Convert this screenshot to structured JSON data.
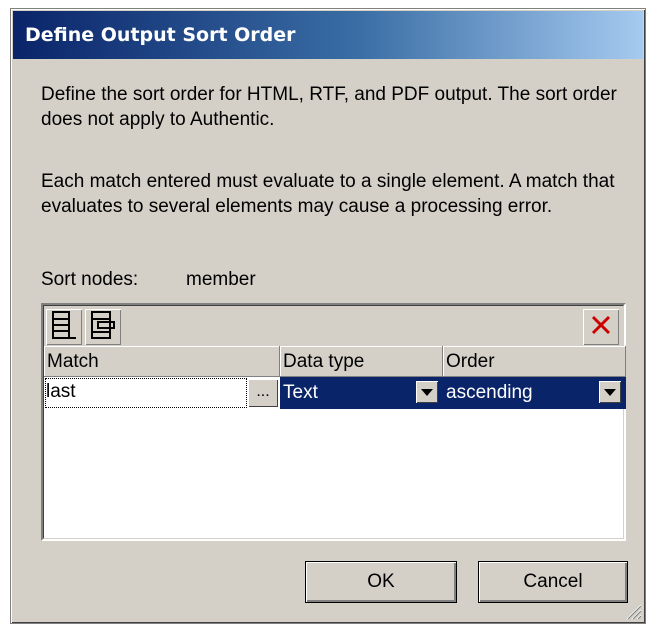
{
  "window": {
    "title": "Define Output Sort Order"
  },
  "description": {
    "para1": "Define the sort order for HTML, RTF, and PDF output. The sort order does not apply to Authentic.",
    "para2": "Each match entered must evaluate to a single element. A match that evaluates to several elements may cause a processing error."
  },
  "sort_nodes": {
    "label": "Sort nodes:",
    "value": "member"
  },
  "toolbar": {
    "icons": [
      "append-row-icon",
      "insert-row-icon",
      "delete-icon"
    ]
  },
  "grid": {
    "columns": {
      "match": "Match",
      "data_type": "Data type",
      "order": "Order"
    },
    "rows": [
      {
        "match": "last",
        "browse": "...",
        "data_type": "Text",
        "order": "ascending"
      }
    ]
  },
  "buttons": {
    "ok": "OK",
    "cancel": "Cancel"
  },
  "colors": {
    "selection": "#0a246a",
    "delete": "#cc0000",
    "face": "#d4d0c8"
  }
}
